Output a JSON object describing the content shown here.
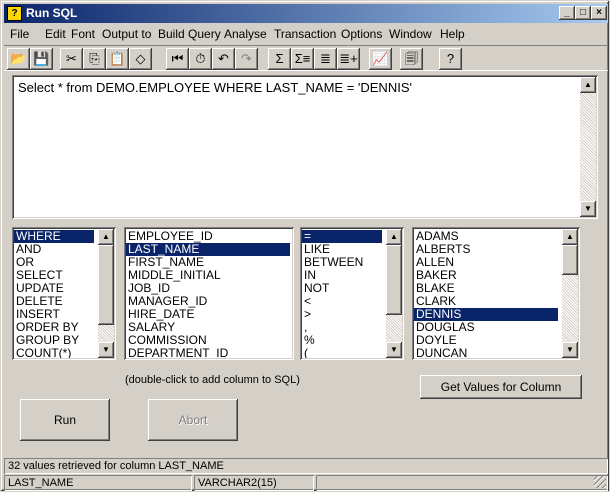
{
  "window": {
    "title": "Run SQL"
  },
  "menu": [
    "File",
    "Edit",
    "Font",
    "Output to",
    "Build Query",
    "Analyse",
    "Transaction",
    "Options",
    "Window",
    "Help"
  ],
  "toolbar": {
    "icons": [
      "open-icon",
      "save-icon",
      "cut-icon",
      "copy-icon",
      "paste-icon",
      "clear-icon",
      "first-record-icon",
      "stopwatch-icon",
      "undo-icon",
      "redo-icon",
      "sum-icon",
      "sum-columns-icon",
      "sort-icon",
      "add-row-icon",
      "chart-icon",
      "export-icon",
      "help-icon"
    ]
  },
  "sql": {
    "text": "Select * from DEMO.EMPLOYEE WHERE LAST_NAME = 'DENNIS'"
  },
  "keywords": {
    "items": [
      "WHERE",
      "AND",
      "OR",
      "SELECT",
      "UPDATE",
      "DELETE",
      "INSERT",
      "ORDER BY",
      "GROUP BY",
      "COUNT(*)"
    ],
    "selected": 0
  },
  "columns": {
    "items": [
      "EMPLOYEE_ID",
      "LAST_NAME",
      "FIRST_NAME",
      "MIDDLE_INITIAL",
      "JOB_ID",
      "MANAGER_ID",
      "HIRE_DATE",
      "SALARY",
      "COMMISSION",
      "DEPARTMENT_ID"
    ],
    "selected": 1
  },
  "operators": {
    "items": [
      "=",
      "LIKE",
      "BETWEEN",
      "IN",
      "NOT",
      "<",
      ">",
      ",",
      "%",
      "("
    ],
    "selected": 0
  },
  "values": {
    "items": [
      "ADAMS",
      "ALBERTS",
      "ALLEN",
      "BAKER",
      "BLAKE",
      "CLARK",
      "DENNIS",
      "DOUGLAS",
      "DOYLE",
      "DUNCAN"
    ],
    "selected": 6
  },
  "hint": "(double-click to add column to SQL)",
  "buttons": {
    "get_values": "Get Values for Column",
    "run": "Run",
    "abort": "Abort"
  },
  "status": {
    "message": "32 values retrieved for column LAST_NAME",
    "column": "LAST_NAME",
    "type": "VARCHAR2(15)",
    "extra": ""
  }
}
